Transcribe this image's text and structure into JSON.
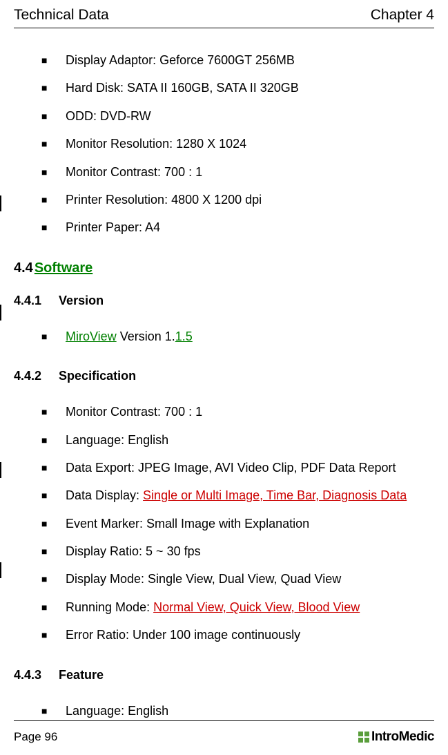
{
  "header": {
    "left": "Technical Data",
    "right": "Chapter 4"
  },
  "list1": {
    "item0": "Display Adaptor: Geforce 7600GT 256MB",
    "item1": "Hard Disk: SATA II 160GB, SATA II 320GB",
    "item2": "ODD: DVD-RW",
    "item3": "Monitor Resolution: 1280 X 1024",
    "item4": "Monitor Contrast: 700 : 1",
    "item5": "Printer Resolution: 4800 X 1200 dpi",
    "item6": "Printer Paper: A4"
  },
  "section44": {
    "number": "4.4",
    "title": "Software"
  },
  "section441": {
    "number": "4.4.1",
    "title": "Version",
    "list": {
      "item0_link1": "MiroView",
      "item0_mid": " Version 1.",
      "item0_link2": "1.5"
    }
  },
  "section442": {
    "number": "4.4.2",
    "title": "Specification",
    "list": {
      "item0": "Monitor Contrast: 700 : 1",
      "item1": "Language: English",
      "item2": "Data Export: JPEG Image, AVI Video Clip, PDF Data Report",
      "item3_prefix": "Data Display: ",
      "item3_link": "Single or Multi Image, Time Bar, Diagnosis Data",
      "item4": "Event Marker: Small Image with Explanation",
      "item5": "Display Ratio: 5 ~ 30 fps",
      "item6": "Display Mode: Single View, Dual View, Quad View",
      "item7_prefix": "Running Mode: ",
      "item7_link": "Normal View, Quick View, Blood View",
      "item8": "Error Ratio: Under 100 image continuously"
    }
  },
  "section443": {
    "number": "4.4.3",
    "title": "Feature",
    "list": {
      "item0": "Language: English"
    }
  },
  "footer": {
    "page": "Page 96",
    "logo": "IntroMedic"
  }
}
